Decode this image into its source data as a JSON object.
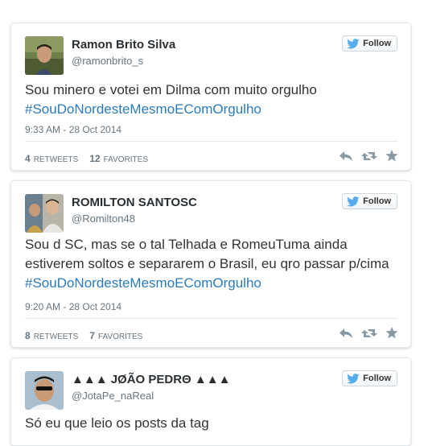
{
  "follow_label": "Follow",
  "tweets": [
    {
      "name": "Ramon Brito Silva",
      "handle": "@ramonbrito_s",
      "text": "Sou minero e votei em Dilma com muito orgulho",
      "hashtag": "#SouDoNordesteMesmoECom​Orgulho",
      "timestamp": "9:33 AM - 28 Oct 2014",
      "retweets": "4",
      "retweets_label": "RETWEETS",
      "favorites": "12",
      "favorites_label": "FAVORITES"
    },
    {
      "name": "ROMILTON SANTOSC",
      "handle": "@Romilton48",
      "text": "Sou d SC, mas se o tal Telhada e RomeuTuma ainda estiverem soltos e separarem o Brasil, eu qro passar p/cima",
      "hashtag": "#SouDoNordesteMesmoECom​Orgulho",
      "timestamp": "9:20 AM - 28 Oct 2014",
      "retweets": "8",
      "retweets_label": "RETWEETS",
      "favorites": "7",
      "favorites_label": "FAVORITES"
    },
    {
      "name": "▲▲▲ JØÃO PΕDRΘ ▲▲▲",
      "handle": "@JotaPe_naReal",
      "text": "Só eu que leio os posts da tag"
    }
  ],
  "colors": {
    "hashtag": "#2b7bb9",
    "twitter_blue": "#55acee",
    "meta_gray": "#66757f"
  },
  "icons": [
    "twitter-bird-icon",
    "reply-icon",
    "retweet-icon",
    "favorite-star-icon"
  ]
}
